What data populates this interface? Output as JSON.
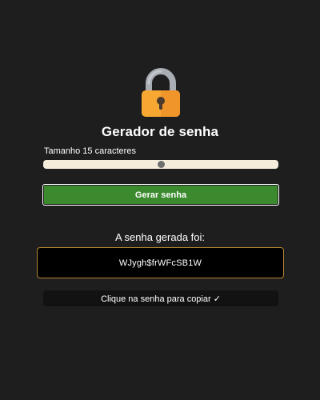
{
  "header": {
    "icon": "padlock-icon",
    "title": "Gerador de senha"
  },
  "length": {
    "label": "Tamanho 15 caracteres",
    "value": 15,
    "slider_fraction": 0.5
  },
  "generate_button": {
    "label": "Gerar senha"
  },
  "result": {
    "title": "A senha gerada foi:",
    "password": "WJygh$frWFcSB1W",
    "copy_hint": "Clique na senha para copiar ✓"
  },
  "colors": {
    "background": "#1e1e1e",
    "button": "#3c8a2e",
    "slider_track": "#f5ecdc",
    "password_border": "#b5862f",
    "lock_body": "#f6a832",
    "lock_shackle": "#a9adb4"
  }
}
